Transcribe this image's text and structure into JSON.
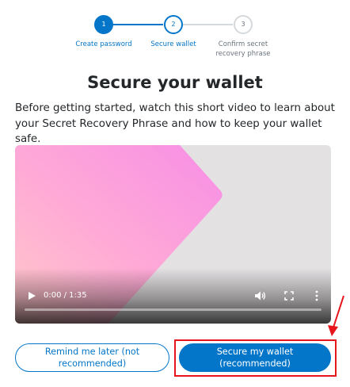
{
  "stepper": {
    "steps": [
      {
        "number": "1",
        "label": "Create password",
        "state": "active"
      },
      {
        "number": "2",
        "label": "Secure wallet",
        "state": "current"
      },
      {
        "number": "3",
        "label": "Confirm secret recovery phrase",
        "state": "pending"
      }
    ]
  },
  "main": {
    "title": "Secure your wallet",
    "description": "Before getting started, watch this short video to learn about your Secret Recovery Phrase and how to keep your wallet safe."
  },
  "video": {
    "time_display": "0:00 / 1:35",
    "progress": 0
  },
  "actions": {
    "remind_later_label": "Remind me later (not recommended)",
    "secure_wallet_label": "Secure my wallet (recommended)"
  },
  "colors": {
    "primary": "#0376c9",
    "pending": "#d6d9dc",
    "annotation": "#e8141b"
  }
}
